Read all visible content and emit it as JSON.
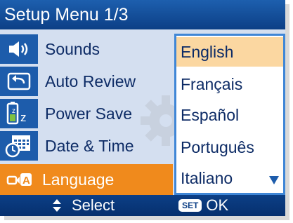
{
  "title": "Setup Menu 1/3",
  "menu": {
    "items": [
      {
        "label": "Sounds",
        "icon": "speaker-icon",
        "selected": false
      },
      {
        "label": "Auto Review",
        "icon": "return-arrow-icon",
        "selected": false
      },
      {
        "label": "Power Save",
        "icon": "battery-sleep-icon",
        "selected": false
      },
      {
        "label": "Date & Time",
        "icon": "calendar-clock-icon",
        "selected": false
      },
      {
        "label": "Language",
        "icon": "language-icon",
        "selected": true
      }
    ]
  },
  "submenu": {
    "items": [
      {
        "label": "English",
        "selected": true
      },
      {
        "label": "Français",
        "selected": false
      },
      {
        "label": "Español",
        "selected": false
      },
      {
        "label": "Português",
        "selected": false
      },
      {
        "label": "Italiano",
        "selected": false
      }
    ],
    "more_indicator": "down-arrow-icon"
  },
  "footer": {
    "select_label": "Select",
    "set_badge": "SET",
    "ok_label": "OK"
  },
  "colors": {
    "accent": "#f08a1c",
    "title_bar": "#0c3f86",
    "panel": "#d4dff0",
    "highlight": "#fbd7a1"
  }
}
